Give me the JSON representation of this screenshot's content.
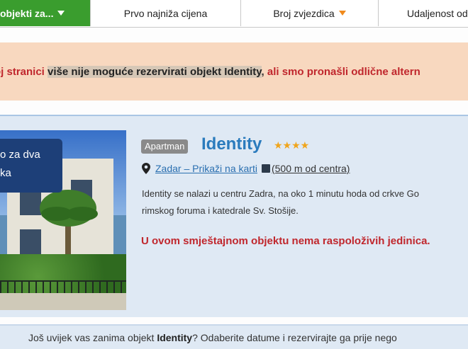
{
  "sort_tabs": [
    {
      "label": "objekti za...",
      "active": true
    },
    {
      "label": "Prvo najniža cijena",
      "active": false
    },
    {
      "label": "Broj zvjezdica",
      "active": false
    },
    {
      "label": "Udaljenost od",
      "active": false
    }
  ],
  "notice": {
    "part1": "oj stranici",
    "part2": "više nije moguće rezervirati objekt Identity",
    "part3": ",",
    "part4": "ali smo pronašli odlične altern"
  },
  "listing": {
    "overlay_line1": "o za dva",
    "overlay_line2": "ka",
    "type_badge": "Apartman",
    "name": "Identity",
    "stars": "★★★★",
    "star_count": 4,
    "location_link": "Zadar – Prikaži na karti",
    "distance": "(500 m od centra)",
    "description_line1": "Identity se nalazi u centru Zadra, na oko 1 minutu hoda od crkve Go",
    "description_line2": "rimskog foruma i katedrale Sv. Stošije.",
    "unavailable": "U ovom smještajnom objektu nema raspoloživih jedinica."
  },
  "footer": {
    "prefix": "Još uvijek vas zanima objekt ",
    "name": "Identity",
    "suffix": "? Odaberite datume i rezervirajte ga prije nego"
  },
  "colors": {
    "active_tab": "#3a9d2e",
    "notice_bg": "#f8d8bf",
    "alert_red": "#c0272d",
    "link_blue": "#2a7bbd",
    "star_orange": "#f0a51c",
    "card_bg": "#dfe9f4"
  },
  "icons": {
    "tab1_caret": "chevron-down-icon",
    "tab3_caret": "chevron-down-icon",
    "location": "map-pin-icon",
    "map": "map-icon"
  }
}
